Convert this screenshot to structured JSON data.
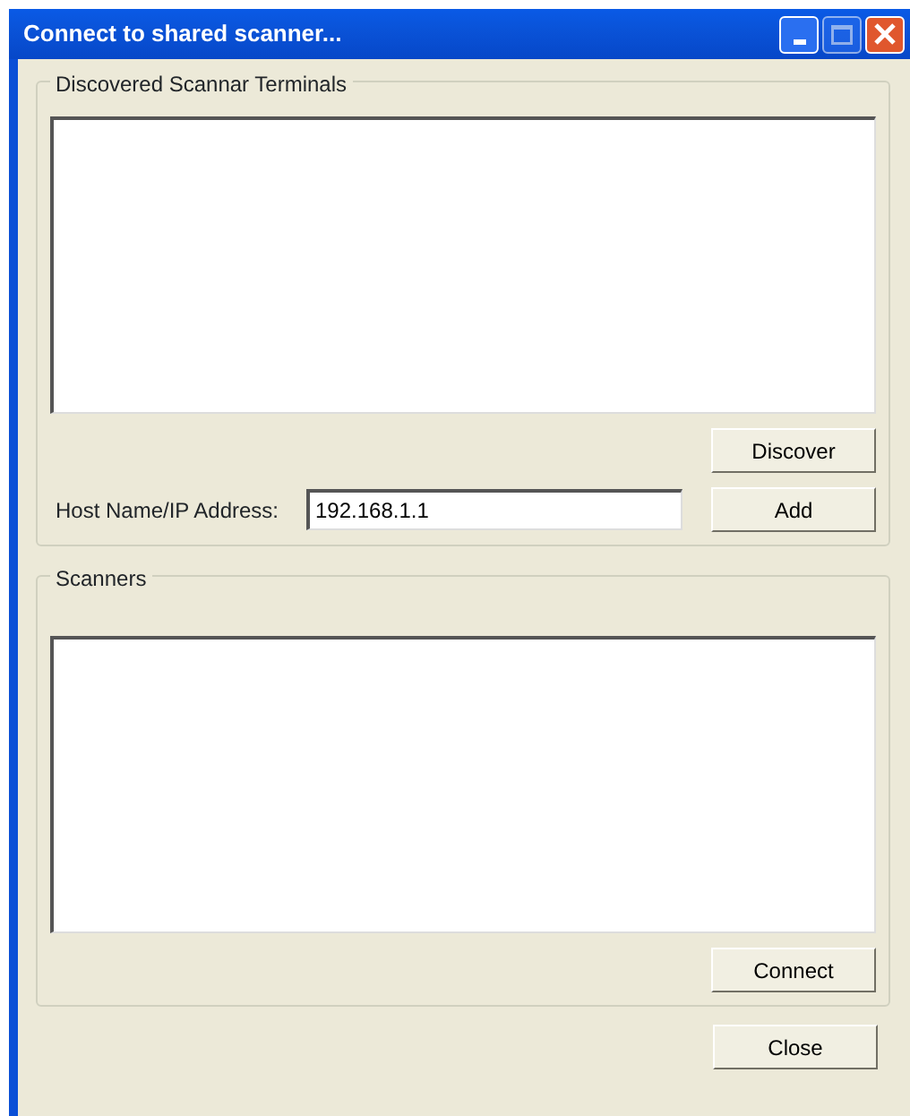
{
  "window": {
    "title": "Connect to shared scanner...",
    "controls": [
      {
        "kind": "minimize",
        "disabled": false
      },
      {
        "kind": "maximize",
        "disabled": true
      },
      {
        "kind": "close",
        "disabled": false
      }
    ]
  },
  "terminals_group": {
    "legend": "Discovered Scannar Terminals",
    "discover_button": "Discover",
    "host_label": "Host Name/IP Address:",
    "host_value": "192.168.1.1",
    "add_button": "Add"
  },
  "scanners_group": {
    "legend": "Scanners",
    "connect_button": "Connect"
  },
  "close_button": "Close"
}
